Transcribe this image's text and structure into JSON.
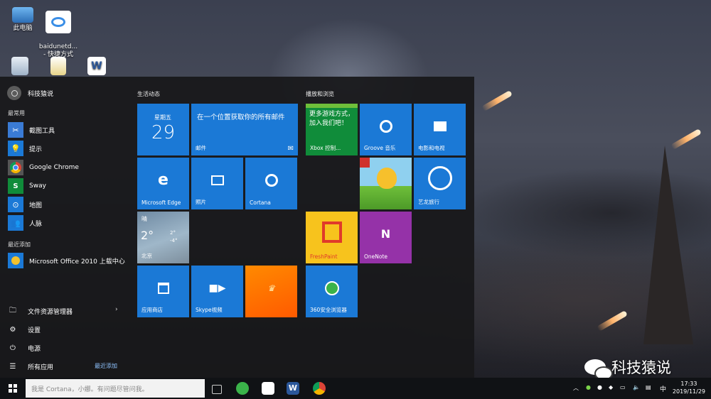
{
  "desktop": {
    "icons": [
      {
        "label": "此电脑"
      },
      {
        "label": "baidunetd...\n- 快捷方式"
      },
      {
        "label": ""
      },
      {
        "label": ""
      },
      {
        "label": ""
      }
    ]
  },
  "start_menu": {
    "user_name": "科技猿说",
    "most_used_label": "最常用",
    "most_used": [
      {
        "label": "截图工具",
        "icon": "scissors-icon",
        "color": "#3a7bd5"
      },
      {
        "label": "提示",
        "icon": "lightbulb-icon",
        "color": "#1b79d6"
      },
      {
        "label": "Google Chrome",
        "icon": "chrome-icon",
        "color": "#dddddd"
      },
      {
        "label": "Sway",
        "icon": "sway-icon",
        "color": "#108c3a"
      },
      {
        "label": "地图",
        "icon": "map-icon",
        "color": "#1b79d6"
      },
      {
        "label": "人脉",
        "icon": "people-icon",
        "color": "#1b79d6"
      }
    ],
    "recently_added_label": "最近添加",
    "recently_added": [
      {
        "label": "Microsoft Office 2010 上载中心",
        "icon": "office-upload-icon",
        "color": "#1b79d6"
      }
    ],
    "system": [
      {
        "label": "文件资源管理器",
        "icon": "folder-icon"
      },
      {
        "label": "设置",
        "icon": "gear-icon"
      },
      {
        "label": "电源",
        "icon": "power-icon"
      },
      {
        "label": "所有应用",
        "icon": "all-apps-icon"
      }
    ],
    "recent_link": "最近添加",
    "groups": [
      {
        "title": "生活动态"
      },
      {
        "title": "播放和浏览"
      }
    ],
    "tiles": {
      "calendar": {
        "day": "星期五",
        "date": "29"
      },
      "mail": {
        "text": "在一个位置获取你的所有邮件",
        "label": "邮件"
      },
      "edge": {
        "label": "Microsoft Edge"
      },
      "photos": {
        "label": "照片"
      },
      "cortana": {
        "label": "Cortana"
      },
      "weather": {
        "cond": "晴",
        "temp": "2°",
        "high": "2°",
        "low": "-4°",
        "city": "北京"
      },
      "store": {
        "label": "应用商店"
      },
      "skype": {
        "label": "Skype视频"
      },
      "king": {
        "label": ""
      },
      "xbox": {
        "text": "更多游戏方式，加入我们吧！",
        "label": "Xbox 控制..."
      },
      "groove": {
        "label": "Groove 音乐"
      },
      "movies": {
        "label": "电影和电视"
      },
      "game": {
        "label": ""
      },
      "elong": {
        "label": "艺龙旅行"
      },
      "freshpaint": {
        "label": "FreshPaint"
      },
      "onenote": {
        "label": "OneNote"
      },
      "browser360": {
        "label": "360安全浏览器"
      }
    }
  },
  "taskbar": {
    "search_placeholder": "我是 Cortana，小娜。有问题尽管问我。",
    "tray_ime": "中",
    "time": "17:33",
    "date": "2019/11/29"
  },
  "watermark": {
    "text": "科技猿说"
  }
}
